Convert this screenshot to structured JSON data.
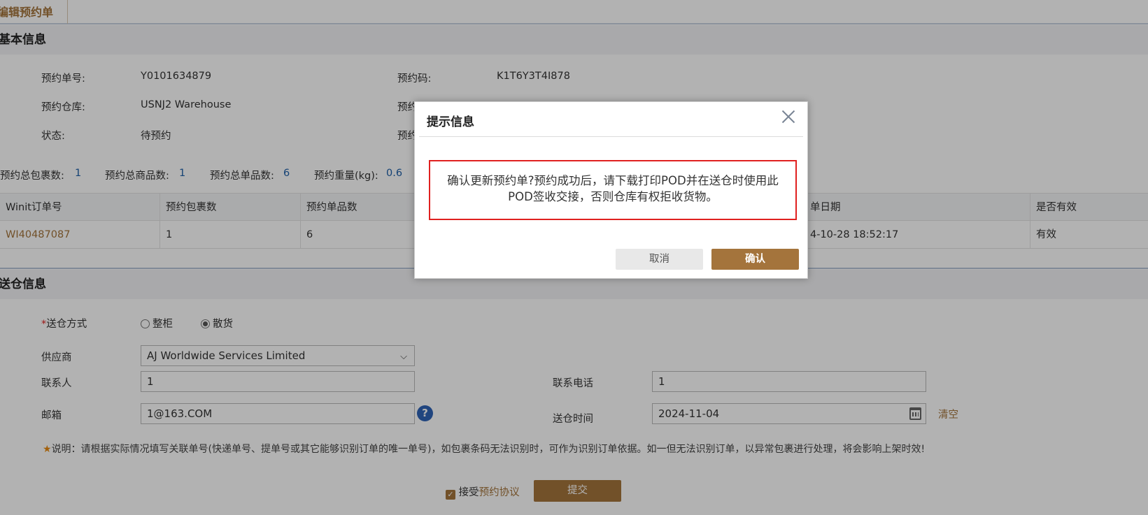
{
  "tab": {
    "title": "编辑预约单"
  },
  "basic": {
    "title": "基本信息",
    "order_no_label": "预约单号:",
    "order_no": "Y0101634879",
    "code_label": "预约码:",
    "code": "K1T6Y3T4I878",
    "warehouse_label": "预约仓库:",
    "warehouse": "USNJ2 Warehouse",
    "status_label": "状态:",
    "status": "待预约",
    "hidden_label_1": "预约",
    "hidden_label_2": "预约"
  },
  "stats": {
    "pkg_label": "预约总包裹数:",
    "pkg": "1",
    "goods_label": "预约总商品数:",
    "goods": "1",
    "items_label": "预约总单品数:",
    "items": "6",
    "weight_label": "预约重量(kg):",
    "weight": "0.6"
  },
  "table": {
    "headers": [
      "Winit订单号",
      "预约包裹数",
      "预约单品数",
      "单日期",
      "是否有效"
    ],
    "rows": [
      {
        "order": "WI40487087",
        "pkgs": "1",
        "items": "6",
        "date": "4-10-28 18:52:17",
        "valid": "有效"
      }
    ]
  },
  "delivery": {
    "title": "送仓信息",
    "required_mark": "*",
    "method_label": "送仓方式",
    "method_options": [
      "整柜",
      "散货"
    ],
    "method_selected": "散货",
    "supplier_label": "供应商",
    "supplier": "AJ Worldwide Services Limited",
    "contact_label": "联系人",
    "contact": "1",
    "phone_label": "联系电话",
    "phone": "1",
    "email_label": "邮箱",
    "email": "1@163.COM",
    "time_label": "送仓时间",
    "time": "2024-11-04",
    "clear_label": "清空",
    "note": "说明：请根据实际情况填写关联单号(快递单号、提单号或其它能够识别订单的唯一单号)，如包裹条码无法识别时，可作为识别订单依据。如一但无法识别订单，以异常包裹进行处理，将会影响上架时效!",
    "accept_prefix": "接受",
    "agreement_link": "预约协议",
    "submit_label": "提交"
  },
  "modal": {
    "title": "提示信息",
    "message": "确认更新预约单?预约成功后，请下载打印POD并在送仓时使用此POD签收交接，否则仓库有权拒收货物。",
    "cancel_label": "取消",
    "confirm_label": "确认"
  },
  "colors": {
    "brand": "#a4743c",
    "accent_blue": "#1e5fa8",
    "alert_red": "#e0201f"
  }
}
